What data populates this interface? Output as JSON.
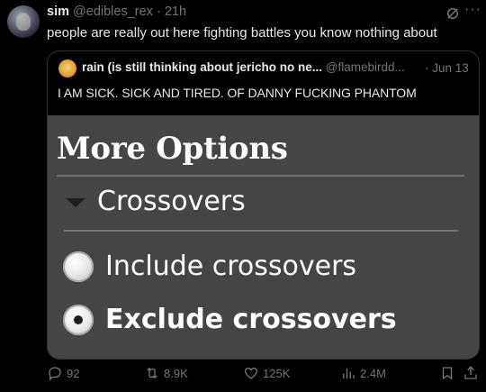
{
  "author": {
    "name": "sim",
    "handle": "@edibles_rex",
    "separator": "·",
    "time": "21h"
  },
  "tweet": {
    "text": "people are really out here fighting battles you know nothing about"
  },
  "quote": {
    "name": "rain (is still thinking about jericho no ne...",
    "handle": "@flamebirdd...",
    "time": "· Jun 13",
    "text": "I AM SICK. SICK AND TIRED. OF DANNY FUCKING PHANTOM",
    "media": {
      "title": "More Options",
      "section": "Crossovers",
      "option_include": "Include crossovers",
      "option_exclude": "Exclude crossovers",
      "selected": "Exclude crossovers"
    }
  },
  "actions": {
    "replies": "92",
    "reposts": "8.9K",
    "likes": "125K",
    "views": "2.4M"
  },
  "icons": {
    "grok": "grok-icon",
    "more": "more-icon",
    "reply": "reply-icon",
    "repost": "repost-icon",
    "like": "like-icon",
    "views": "views-icon",
    "bookmark": "bookmark-icon",
    "share": "share-icon"
  },
  "colors": {
    "background": "#000000",
    "text": "#e7e9ea",
    "muted": "#71767b",
    "border": "#2f3336",
    "media_bg": "#444546"
  }
}
